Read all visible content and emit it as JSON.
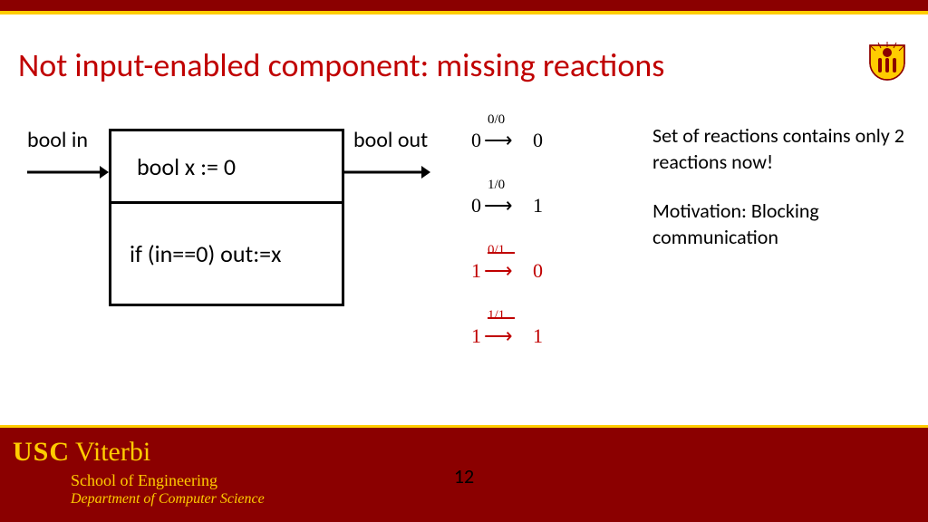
{
  "title": "Not input-enabled component: missing reactions",
  "labels": {
    "in": "bool in",
    "out": "bool out"
  },
  "component": {
    "top": "bool x := 0",
    "bottom": "if (in==0) out:=x"
  },
  "reactions": [
    {
      "from": "0",
      "io": "0/0",
      "to": "0",
      "struck": false
    },
    {
      "from": "0",
      "io": "1/0",
      "to": "1",
      "struck": false
    },
    {
      "from": "1",
      "io": "0/1",
      "to": "0",
      "struck": true
    },
    {
      "from": "1",
      "io": "1/1",
      "to": "1",
      "struck": true
    }
  ],
  "notes": {
    "p1": "Set of reactions contains only 2 reactions now!",
    "p2": "Motivation: Blocking communication"
  },
  "footer": {
    "usc": "USC",
    "viterbi": "Viterbi",
    "school": "School of Engineering",
    "dept": "Department of  Computer Science",
    "page": "12"
  }
}
